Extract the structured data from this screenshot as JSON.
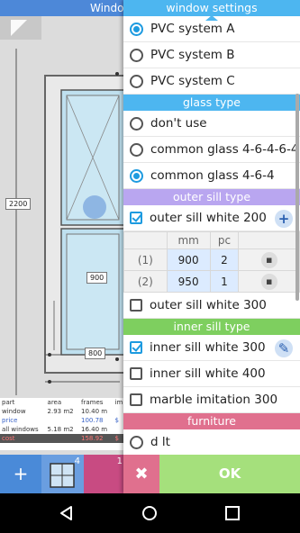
{
  "background": {
    "title": "Windo",
    "dimensions": {
      "height": "2200",
      "inner": "900",
      "width": "800"
    },
    "summary": {
      "headers": [
        "part",
        "area",
        "frames",
        "im"
      ],
      "rows": [
        {
          "label": "window",
          "area": "2.93 m2",
          "frames": "10.40 m",
          "extra": ""
        },
        {
          "label": "price",
          "area": "",
          "frames": "100.78",
          "extra": "$"
        },
        {
          "label": "all windows",
          "area": "5.18 m2",
          "frames": "16.40 m",
          "extra": ""
        },
        {
          "label": "cost",
          "area": "",
          "frames": "158.92",
          "extra": "$"
        }
      ]
    },
    "add_label": "+",
    "thumb_counts": [
      "4",
      "1"
    ]
  },
  "dialog": {
    "window_settings": {
      "header": "window settings",
      "options": [
        {
          "label": "PVC system A",
          "selected": true
        },
        {
          "label": "PVC system B",
          "selected": false
        },
        {
          "label": "PVC system C",
          "selected": false
        }
      ]
    },
    "glass_type": {
      "header": "glass type",
      "options": [
        {
          "label": "don't use",
          "selected": false
        },
        {
          "label": "common glass 4-6-4-6-4",
          "selected": false
        },
        {
          "label": "common glass 4-6-4",
          "selected": true
        }
      ]
    },
    "outer_sill": {
      "header": "outer sill type",
      "items": [
        {
          "label": "outer sill white 200",
          "checked": true
        },
        {
          "label": "outer sill white 300",
          "checked": false
        }
      ],
      "add_button": "+",
      "table": {
        "col_mm": "mm",
        "col_pc": "pc",
        "rows": [
          {
            "idx": "(1)",
            "mm": "900",
            "pc": "2"
          },
          {
            "idx": "(2)",
            "mm": "950",
            "pc": "1"
          }
        ]
      }
    },
    "inner_sill": {
      "header": "inner sill type",
      "items": [
        {
          "label": "inner sill white 300",
          "checked": true
        },
        {
          "label": "inner sill white 400",
          "checked": false
        },
        {
          "label": "marble imitation 300",
          "checked": false
        }
      ]
    },
    "furniture": {
      "header": "furniture",
      "partial_item": "d   lt"
    },
    "cancel_label": "✖",
    "ok_label": "OK"
  },
  "colors": {
    "header_blue": "#4db6f0",
    "header_lilac": "#b9a6f0",
    "header_green": "#7ecf5f",
    "header_pink": "#e0708e",
    "ok_green": "#a5e07c",
    "accent": "#1e9be0"
  }
}
